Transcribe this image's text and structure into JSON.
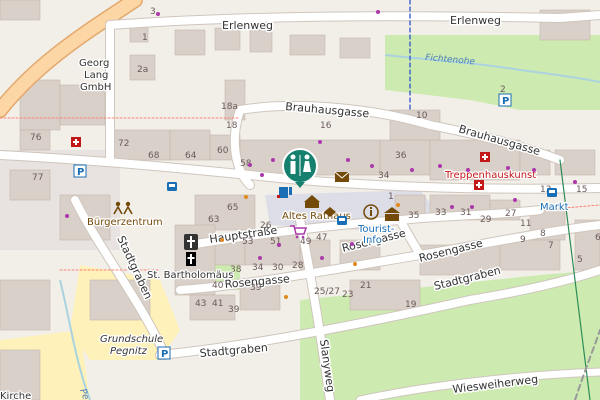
{
  "streets": {
    "erlenweg_1": "Erlenweg",
    "erlenweg_2": "Erlenweg",
    "brauhausgasse_1": "Brauhausgasse",
    "brauhausgasse_2": "Brauhausgasse",
    "hauptstrasse": "Hauptstraße",
    "rosengasse_1": "Rosengasse",
    "rosengasse_2": "Rosengasse",
    "rosengasse_3": "Rosengasse",
    "stadtgraben_1": "Stadtgraben",
    "stadtgraben_2": "Stadtgraben",
    "stadtgraben_3": "Stadtgraben",
    "slanyweg": "Slanyweg",
    "wiesweiherweg": "Wiesweiherweg",
    "fichtenohe": "Fichtenohe"
  },
  "pois": {
    "georg_lang_1": "Georg",
    "georg_lang_2": "Lang",
    "georg_lang_3": "GmbH",
    "burgerzentrum": "Bürgerzentrum",
    "st_bartholomaus": "St. Bartholomäus",
    "altes_rathaus": "Altes Rathaus",
    "tourist_info_1": "Tourist-",
    "tourist_info_2": "Info",
    "treppenhauskunst": "Treppenhauskunst",
    "markt": "Markt",
    "grundschule_1": "Grundschule",
    "grundschule_2": "Pegnitz",
    "kirche": "Kirche",
    "pegnitz_river": "Pe"
  },
  "house_numbers": {
    "h3": "3",
    "h2a": "2a",
    "h1": "1",
    "h76": "76",
    "h77": "77",
    "h72": "72",
    "h68": "68",
    "h64": "64",
    "h60": "60",
    "h58": "58",
    "h18a": "18a",
    "h18": "18",
    "h16": "16",
    "h10": "10",
    "h2b": "2",
    "h36": "36",
    "h34": "34",
    "h65": "65",
    "h63": "63",
    "h53": "53",
    "h51": "51",
    "h49": "49",
    "h47": "47",
    "h26": "26",
    "h38": "38",
    "h34b": "34",
    "h30": "30",
    "h28": "28",
    "h1b": "1",
    "h35": "35",
    "h33": "33",
    "h31": "31",
    "h29": "29",
    "h27": "27",
    "h13": "13",
    "h15": "15",
    "h11": "11",
    "h9": "9",
    "h8": "8",
    "h7": "7",
    "h5": "5",
    "h6": "6",
    "h39": "39",
    "h40": "40",
    "h43": "43",
    "h41": "41",
    "h25_27": "25/27",
    "h23": "23",
    "h21": "21",
    "h19": "19"
  },
  "colors": {
    "background": "#f2efe9",
    "building": "#d9d0c9",
    "road": "#ffffff",
    "main_road": "#fcd6a4",
    "green": "#cdebb0",
    "pedestrian": "#dddde8",
    "water": "#aad3df",
    "poi_brown": "#734a08",
    "poi_red": "#c21818",
    "poi_blue": "#1a6eb5"
  },
  "icons": [
    "toilets-icon",
    "post-office-icon",
    "town-hall-icon",
    "tourist-info-icon",
    "museum-icon",
    "pharmacy-icon",
    "church-icon",
    "community-centre-icon",
    "parking-icon",
    "bus-stop-icon",
    "fuel-charging-icon",
    "shop-icon",
    "viewpoint-icon"
  ]
}
